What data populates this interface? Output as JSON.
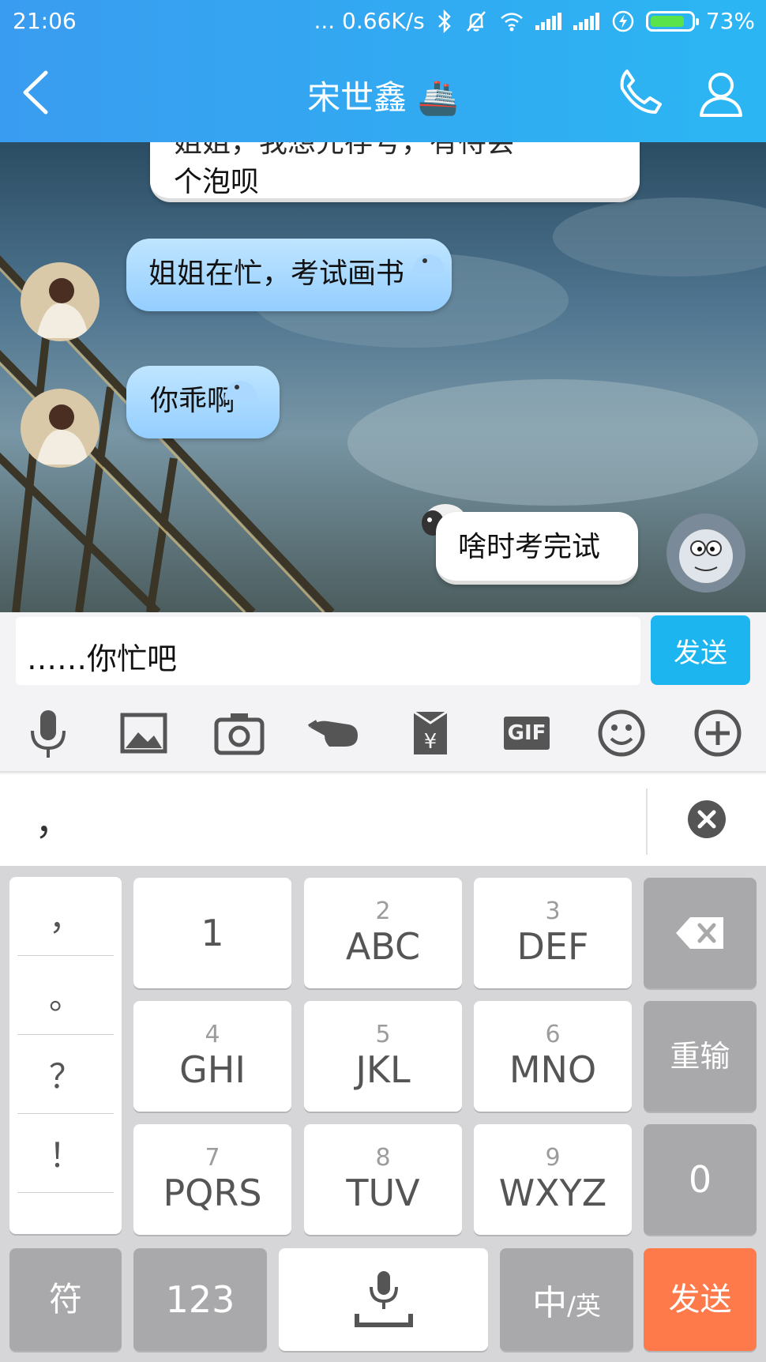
{
  "status_bar": {
    "time": "21:06",
    "net_speed": "... 0.66K/s",
    "battery_percent": "73%"
  },
  "header": {
    "title": "宋世鑫",
    "title_emoji": "🚢",
    "icons": [
      "back-arrow-icon",
      "phone-icon",
      "profile-icon"
    ]
  },
  "messages": [
    {
      "side": "right",
      "text_line1": "姐姐，我想先存号，有待会",
      "text_line2": "个泡呗",
      "partially_hidden": true
    },
    {
      "side": "left",
      "text": "姐姐在忙，考试画书"
    },
    {
      "side": "left",
      "text": "你乖啊"
    },
    {
      "side": "right",
      "text": "啥时考完试"
    }
  ],
  "input": {
    "value": "……你忙吧",
    "send_label": "发送"
  },
  "toolbar": {
    "items": [
      "microphone-icon",
      "image-icon",
      "camera-icon",
      "poke-hand-icon",
      "red-packet-icon",
      "gif-icon",
      "emoji-icon",
      "plus-icon"
    ],
    "gif_label": "GIF"
  },
  "candidate": {
    "text": "，"
  },
  "keyboard": {
    "punctuation": [
      "，",
      "。",
      "？",
      "！"
    ],
    "keys": [
      {
        "num": "",
        "letters": "1"
      },
      {
        "num": "2",
        "letters": "ABC"
      },
      {
        "num": "3",
        "letters": "DEF"
      },
      {
        "num": "4",
        "letters": "GHI"
      },
      {
        "num": "5",
        "letters": "JKL"
      },
      {
        "num": "6",
        "letters": "MNO"
      },
      {
        "num": "7",
        "letters": "PQRS"
      },
      {
        "num": "8",
        "letters": "TUV"
      },
      {
        "num": "9",
        "letters": "WXYZ"
      }
    ],
    "retype": "重输",
    "zero": "0",
    "symbols": "符",
    "numbers": "123",
    "lang_main": "中",
    "lang_sub": "/英",
    "send": "发送"
  },
  "colors": {
    "header": "#2bb6f3",
    "send_button": "#1cb5f0",
    "keyboard_send": "#ff7a4a"
  }
}
